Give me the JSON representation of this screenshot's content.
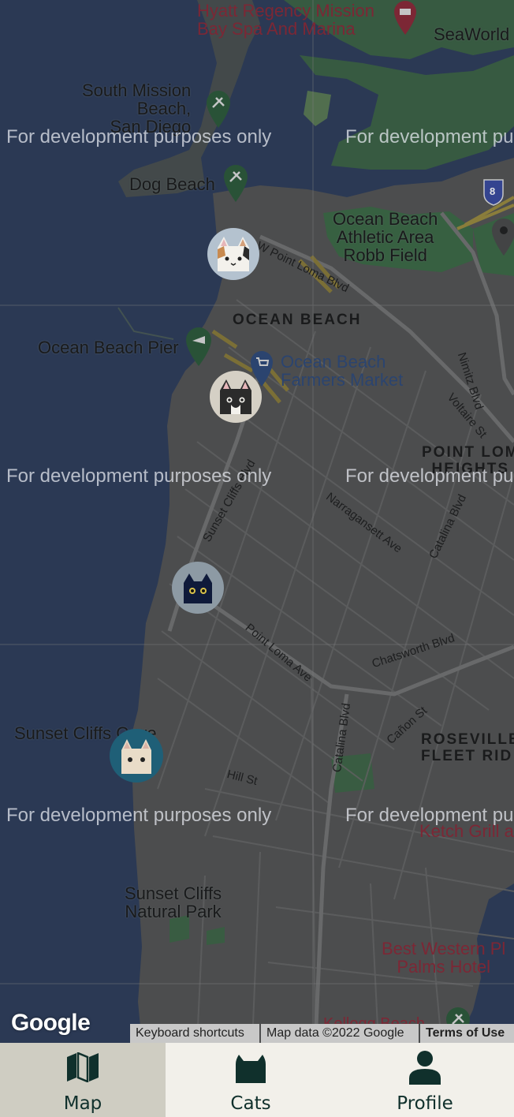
{
  "map": {
    "places": {
      "hyatt": "Hyatt Regency Mission\nBay Spa And Marina",
      "seaworld": "SeaWorld",
      "south_mission_beach": "South Mission\nBeach,\nSan Diego",
      "dog_beach": "Dog Beach",
      "robb_field": "Ocean Beach\nAthletic Area\nRobb Field",
      "ocean_beach": "OCEAN BEACH",
      "ocean_beach_pier": "Ocean Beach Pier",
      "farmers_market": "Ocean Beach\nFarmers Market",
      "point_loma_heights": "POINT LOM\nHEIGHTS",
      "sunset_cliffs_cave": "Sunset Cliffs Cave",
      "roseville": "ROSEVILLE\nFLEET RID",
      "ketch_grill": "Ketch Grill a",
      "sunset_cliffs_park": "Sunset Cliffs\nNatural Park",
      "best_western": "Best Western Pl\nPalms Hotel",
      "kellogg_beach": "Kellogg Beach",
      "interstate": "8"
    },
    "streets": {
      "w_point_loma": "W Point Loma Blvd",
      "nimitz": "Nimitz Blvd",
      "voltaire": "Voltaire St",
      "sunset_cliffs_blvd": "Sunset Cliffs Blvd",
      "narragansett": "Narragansett Ave",
      "catalina_upper": "Catalina Blvd",
      "point_loma_ave": "Point Loma Ave",
      "chatsworth": "Chatsworth Blvd",
      "catalina_lower": "Catalina Blvd",
      "canon": "Cañon St",
      "hill": "Hill St"
    },
    "watermark": "For development purposes only",
    "watermark_cut": "For development pu",
    "google_logo": "Google",
    "attribution": {
      "shortcuts": "Keyboard shortcuts",
      "map_data": "Map data ©2022 Google",
      "terms": "Terms of Use"
    },
    "cat_markers": [
      {
        "name": "calico-cat",
        "bg": "#b4c2cf"
      },
      {
        "name": "black-white-cat",
        "bg": "#d5d0c5"
      },
      {
        "name": "black-cat",
        "bg": "#8d9aa4"
      },
      {
        "name": "cream-cat",
        "bg": "#1f5f77"
      }
    ]
  },
  "nav": {
    "tabs": [
      {
        "label": "Map",
        "icon": "map-icon",
        "active": true
      },
      {
        "label": "Cats",
        "icon": "cat-icon",
        "active": false
      },
      {
        "label": "Profile",
        "icon": "person-icon",
        "active": false
      }
    ]
  },
  "colors": {
    "water": "#2f3e5c",
    "land": "#555555",
    "park": "#3d6a46",
    "nav_bg": "#f2f0ea",
    "nav_active": "#cfcdc2",
    "nav_icon": "#10302c"
  }
}
